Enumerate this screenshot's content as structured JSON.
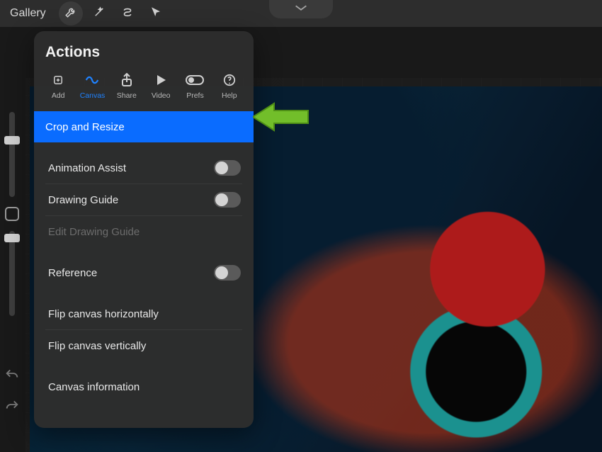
{
  "topbar": {
    "gallery_label": "Gallery"
  },
  "panel": {
    "title": "Actions",
    "tabs": [
      {
        "label": "Add"
      },
      {
        "label": "Canvas"
      },
      {
        "label": "Share"
      },
      {
        "label": "Video"
      },
      {
        "label": "Prefs"
      },
      {
        "label": "Help"
      }
    ]
  },
  "menu": {
    "crop_resize": "Crop and Resize",
    "animation_assist": "Animation Assist",
    "drawing_guide": "Drawing Guide",
    "edit_drawing_guide": "Edit Drawing Guide",
    "reference": "Reference",
    "flip_h": "Flip canvas horizontally",
    "flip_v": "Flip canvas vertically",
    "canvas_info": "Canvas information"
  }
}
